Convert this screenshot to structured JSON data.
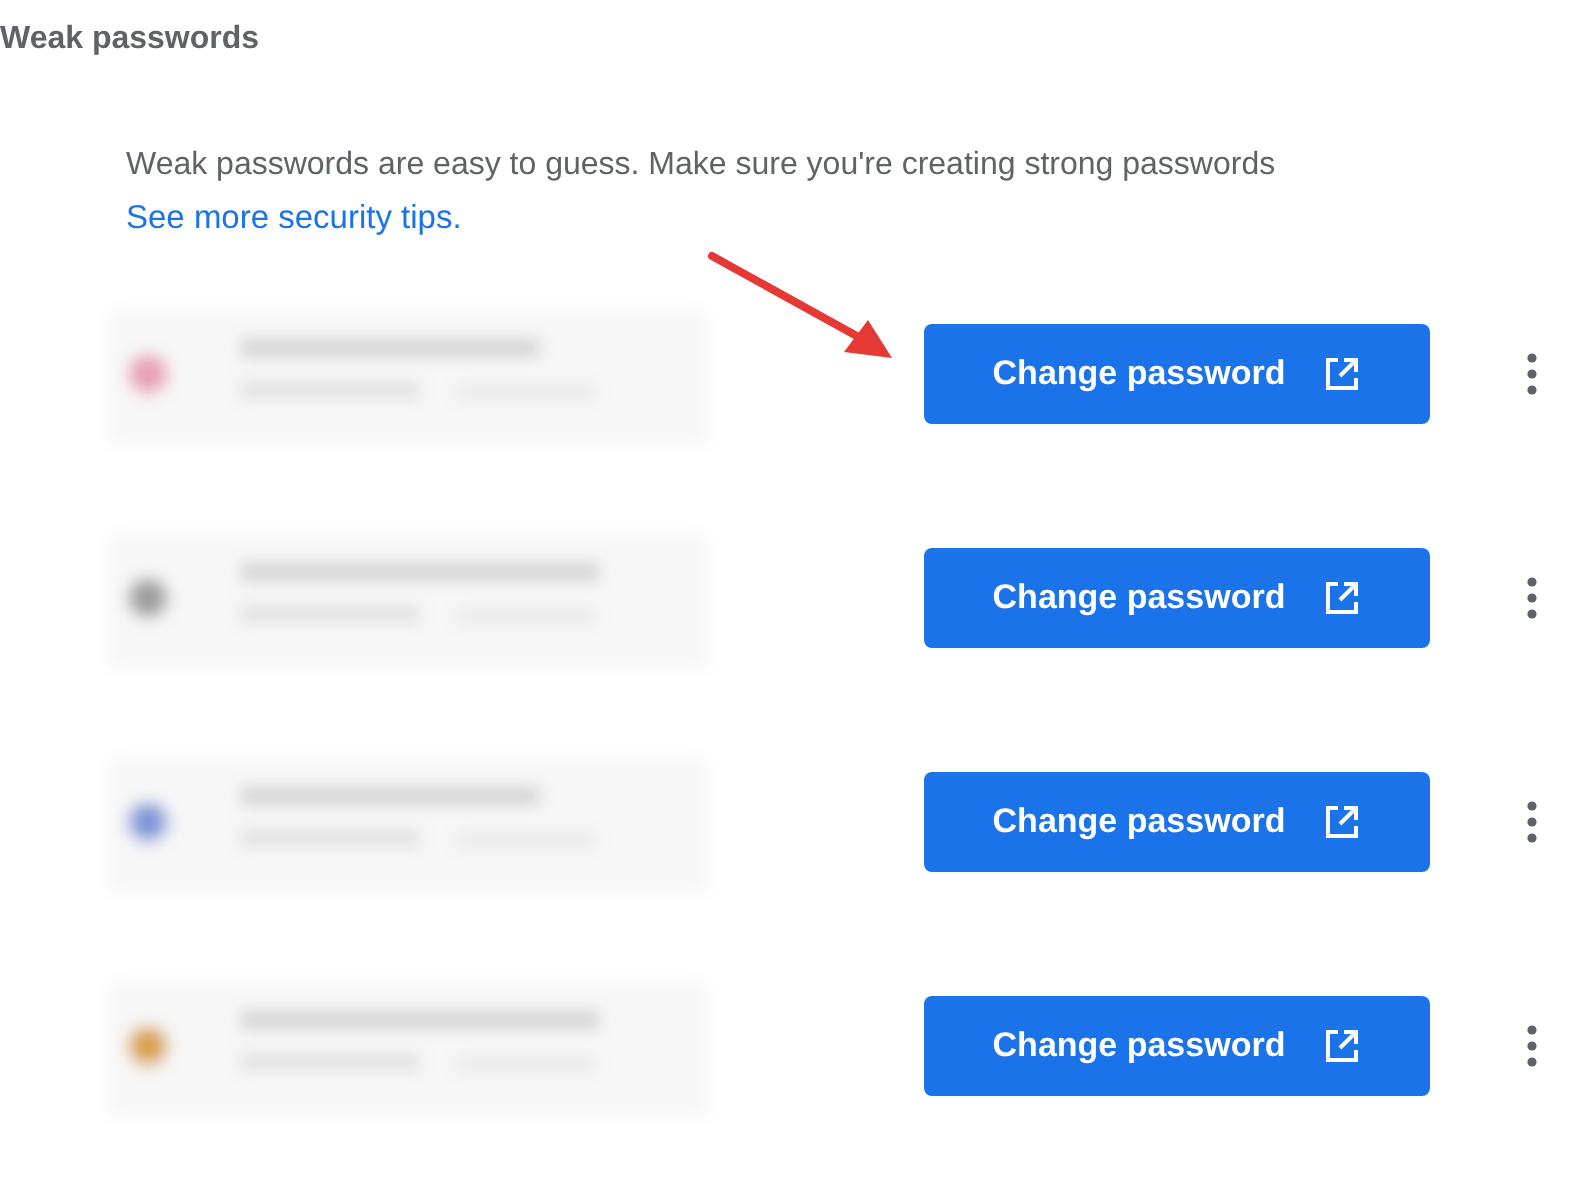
{
  "section_title": "Weak passwords",
  "description": "Weak passwords are easy to guess. Make sure you're creating strong passwords",
  "link": "See more security tips.",
  "entries": [
    {
      "color": "#e8a0b4",
      "button": "Change password"
    },
    {
      "color": "#9e9e9e",
      "button": "Change password"
    },
    {
      "color": "#7f95d8",
      "button": "Change password"
    },
    {
      "color": "#d9a24a",
      "button": "Change password"
    }
  ]
}
